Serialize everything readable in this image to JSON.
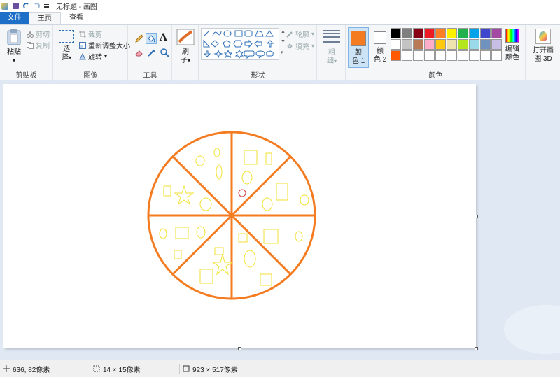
{
  "window": {
    "title": "无标题 - 画图"
  },
  "tabs": {
    "file": "文件",
    "home": "主页",
    "view": "查看"
  },
  "clipboard": {
    "paste": "粘贴",
    "cut": "剪切",
    "copy": "复制",
    "group": "剪贴板"
  },
  "image": {
    "select": "选",
    "select2": "择",
    "crop": "裁剪",
    "resize": "重新调整大小",
    "rotate": "旋转",
    "group": "图像"
  },
  "tools": {
    "group": "工具"
  },
  "brushes": {
    "label": "刷",
    "label2": "子"
  },
  "shapes": {
    "outline": "轮廓",
    "fill": "填充",
    "group": "形状"
  },
  "size": {
    "label": "粗",
    "label2": "细"
  },
  "colors": {
    "color1": "颜",
    "color1b": "色 1",
    "color2": "颜",
    "color2b": "色 2",
    "edit": "编辑",
    "edit2": "颜色",
    "group": "颜色",
    "color1_hex": "#f47b20",
    "color2_hex": "#ffffff",
    "palette": [
      "#000000",
      "#7f7f7f",
      "#880015",
      "#ed1c24",
      "#ff7f27",
      "#fff200",
      "#22b14c",
      "#00a2e8",
      "#3f48cc",
      "#a349a4",
      "#ffffff",
      "#c3c3c3",
      "#b97a57",
      "#ffaec9",
      "#ffc90e",
      "#efe4b0",
      "#b5e61d",
      "#99d9ea",
      "#7092be",
      "#c8bfe7",
      "#ff5a00",
      "#ffffff",
      "#ffffff",
      "#ffffff",
      "#ffffff",
      "#ffffff",
      "#ffffff",
      "#ffffff",
      "#ffffff",
      "#ffffff"
    ]
  },
  "paint3d": {
    "label": "打开画",
    "label2": "图 3D"
  },
  "status": {
    "cursor": "636, 82像素",
    "selection": "14 × 15像素",
    "canvas": "923 × 517像素"
  }
}
